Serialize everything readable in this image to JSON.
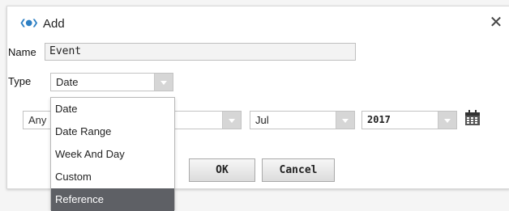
{
  "dialog": {
    "title": "Add",
    "close_glyph": "✕",
    "icon": "niagara-logo-icon"
  },
  "form": {
    "name_label": "Name",
    "name_value": "Event",
    "type_label": "Type",
    "type_value": "Date",
    "day_value": "Any",
    "month_value": "Jul",
    "year_value": "2017"
  },
  "dropdown": {
    "items": [
      "Date",
      "Date Range",
      "Week And Day",
      "Custom",
      "Reference"
    ],
    "highlighted": "Reference"
  },
  "buttons": {
    "ok": "OK",
    "cancel": "Cancel"
  },
  "colors": {
    "accent": "#2d7fc3",
    "highlight": "#5e6065"
  }
}
